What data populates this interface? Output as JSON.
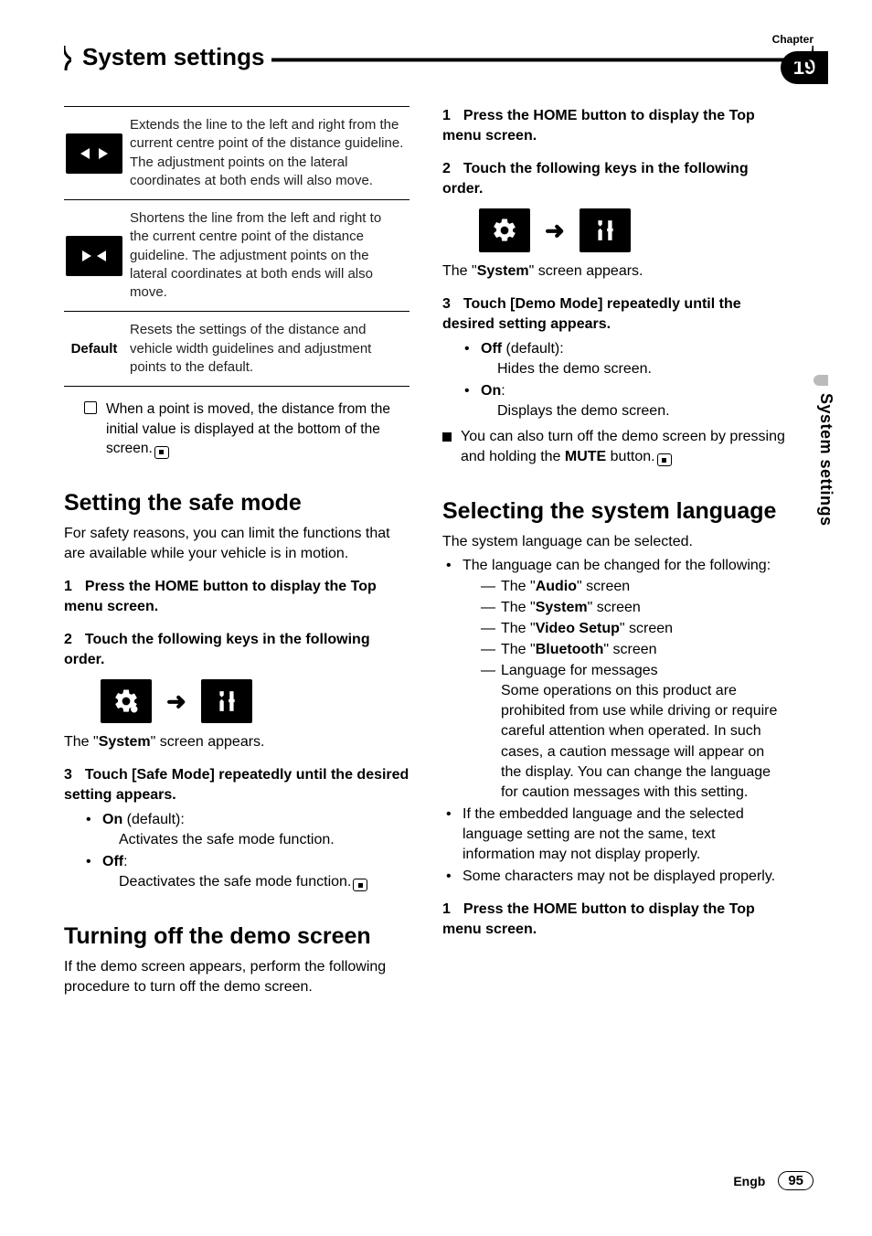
{
  "header": {
    "chapter_label": "Chapter",
    "chapter_number": "19",
    "title": "System settings",
    "side_title": "System settings"
  },
  "left": {
    "table": [
      {
        "icon": "expand",
        "desc": "Extends the line to the left and right from the current centre point of the distance guideline. The adjustment points on the lateral coordinates at both ends will also move."
      },
      {
        "icon": "shorten",
        "desc": "Shortens the line from the left and right to the current centre point of the distance guideline. The adjustment points on the lateral coordinates at both ends will also move."
      },
      {
        "icon": "default",
        "label": "Default",
        "desc": "Resets the settings of the distance and vehicle width guidelines and adjustment points to the default."
      }
    ],
    "note": "When a point is moved, the distance from the initial value is displayed at the bottom of the screen.",
    "safe": {
      "title": "Setting the safe mode",
      "intro": "For safety reasons, you can limit the functions that are available while your vehicle is in motion.",
      "step1": "Press the HOME button to display the Top menu screen.",
      "step2": "Touch the following keys in the following order.",
      "appears_pre": "The \"",
      "appears_bold": "System",
      "appears_post": "\" screen appears.",
      "step3": "Touch [Safe Mode] repeatedly until the desired setting appears.",
      "on_label": "On",
      "on_suffix": " (default):",
      "on_desc": "Activates the safe mode function.",
      "off_label": "Off",
      "off_suffix": ":",
      "off_desc": "Deactivates the safe mode function."
    },
    "demo": {
      "title": "Turning off the demo screen",
      "intro": "If the demo screen appears, perform the following procedure to turn off the demo screen."
    }
  },
  "right": {
    "step1": "Press the HOME button to display the Top menu screen.",
    "step2": "Touch the following keys in the following order.",
    "appears_pre": "The \"",
    "appears_bold": "System",
    "appears_post": "\" screen appears.",
    "step3": "Touch [Demo Mode] repeatedly until the desired setting appears.",
    "off_label": "Off",
    "off_suffix": " (default):",
    "off_desc": "Hides the demo screen.",
    "on_label": "On",
    "on_suffix": ":",
    "on_desc": "Displays the demo screen.",
    "mute_pre": "You can also turn off the demo screen by pressing and holding the ",
    "mute_bold": "MUTE",
    "mute_post": " button.",
    "lang": {
      "title": "Selecting the system language",
      "intro": "The system language can be selected.",
      "b1": "The language can be changed for the following:",
      "d_pre": "The \"",
      "d1": "Audio",
      "d2": "System",
      "d3": "Video Setup",
      "d4": "Bluetooth",
      "d_post": "\" screen",
      "d5_a": "Language for messages",
      "d5_b": "Some operations on this product are prohibited from use while driving or require careful attention when operated. In such cases, a caution message will appear on the display. You can change the language for caution messages with this setting.",
      "b2": "If the embedded language and the selected language setting are not the same, text information may not display properly.",
      "b3": "Some characters may not be displayed properly.",
      "step1": "Press the HOME button to display the Top menu screen."
    }
  },
  "footer": {
    "lang": "Engb",
    "page": "95"
  }
}
